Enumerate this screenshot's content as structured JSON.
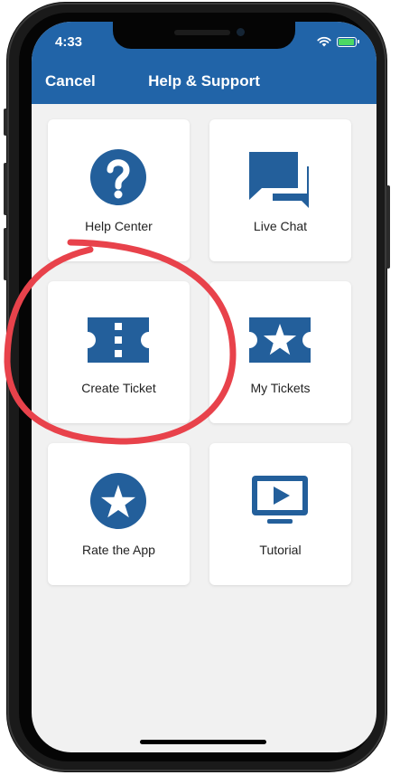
{
  "status_bar": {
    "time": "4:33"
  },
  "header": {
    "cancel_label": "Cancel",
    "title": "Help & Support"
  },
  "tiles": [
    {
      "label": "Help Center",
      "icon": "question-circle-icon"
    },
    {
      "label": "Live Chat",
      "icon": "chat-bubbles-icon"
    },
    {
      "label": "Create Ticket",
      "icon": "ticket-icon"
    },
    {
      "label": "My Tickets",
      "icon": "ticket-star-icon"
    },
    {
      "label": "Rate the App",
      "icon": "star-circle-icon"
    },
    {
      "label": "Tutorial",
      "icon": "video-play-icon"
    }
  ],
  "colors": {
    "accent": "#2164a8",
    "icon": "#235f9b",
    "annotation": "#e8424b",
    "background": "#f1f1f1"
  },
  "annotation": {
    "highlighted_item": "Create Ticket"
  }
}
